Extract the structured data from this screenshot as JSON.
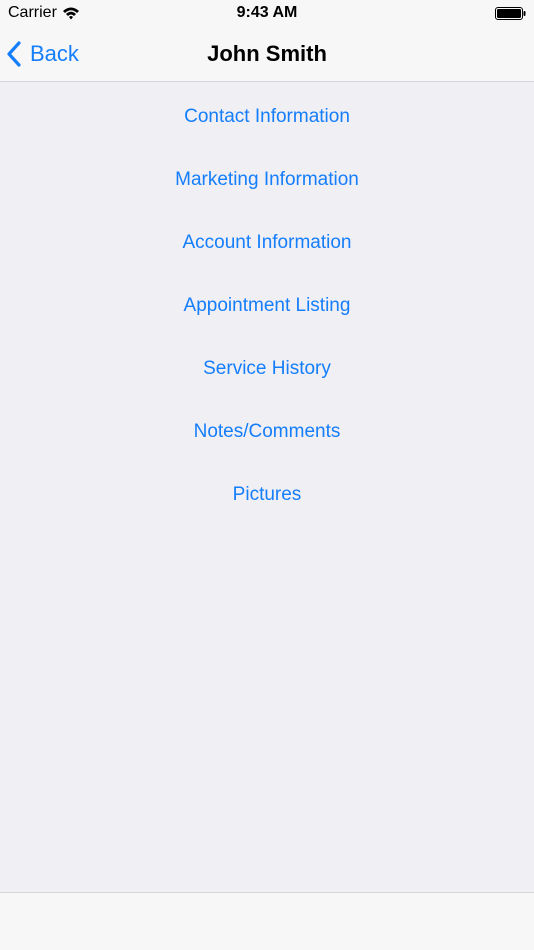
{
  "status_bar": {
    "carrier": "Carrier",
    "time": "9:43 AM",
    "icons": [
      "wifi-icon",
      "battery-icon"
    ]
  },
  "nav_bar": {
    "back_label": "Back",
    "back_icon": "chevron-left-icon",
    "title": "John Smith"
  },
  "menu": {
    "items": [
      {
        "label": "Contact Information"
      },
      {
        "label": "Marketing Information"
      },
      {
        "label": "Account Information"
      },
      {
        "label": "Appointment Listing"
      },
      {
        "label": "Service History"
      },
      {
        "label": "Notes/Comments"
      },
      {
        "label": "Pictures"
      }
    ]
  },
  "colors": {
    "accent": "#157efb",
    "background": "#efeff4",
    "bar_background": "#f7f7f7",
    "divider": "#d6d6da",
    "text": "#000000"
  }
}
